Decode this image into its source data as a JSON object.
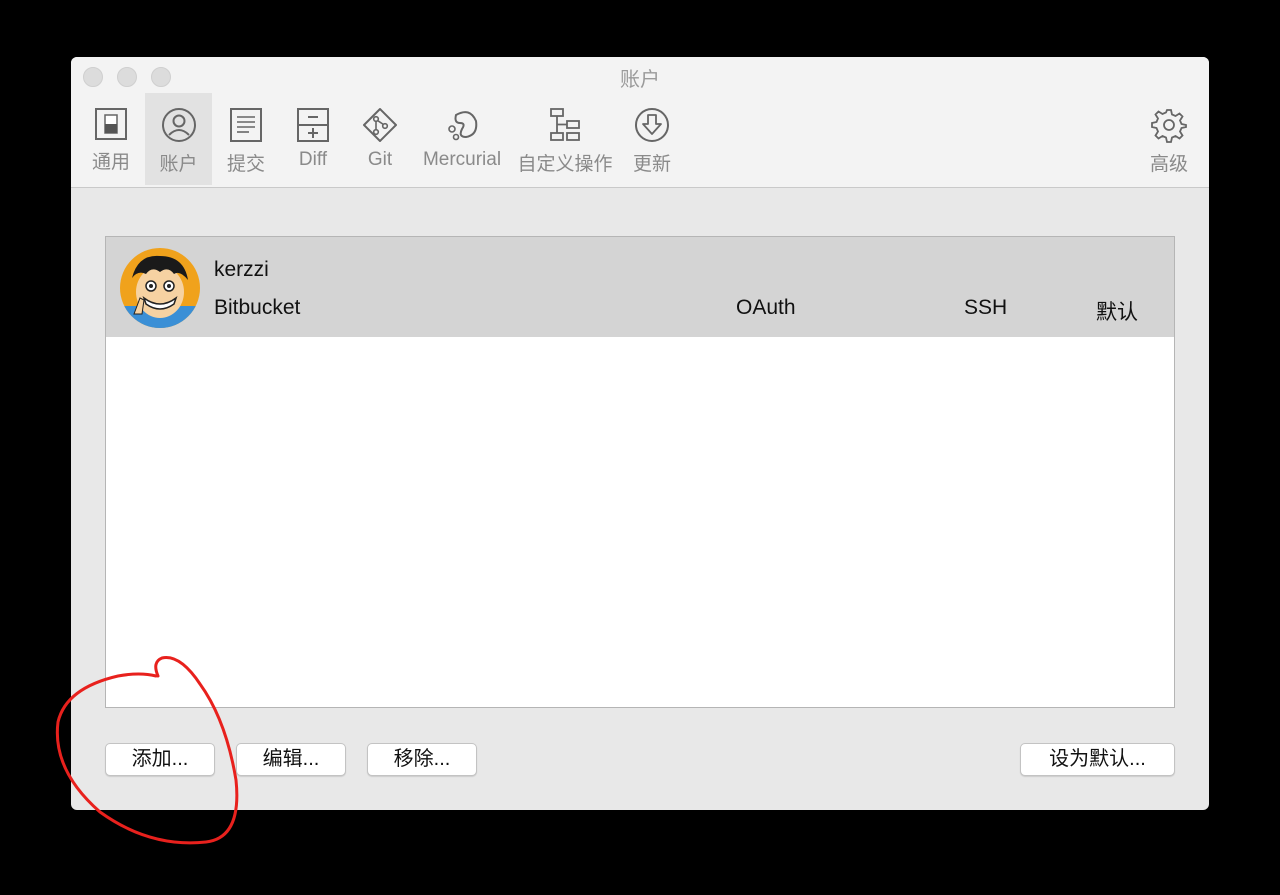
{
  "window": {
    "title": "账户"
  },
  "toolbar": {
    "items": [
      {
        "label": "通用",
        "icon": "switch-icon"
      },
      {
        "label": "账户",
        "icon": "account-icon",
        "active": true
      },
      {
        "label": "提交",
        "icon": "commit-icon"
      },
      {
        "label": "Diff",
        "icon": "diff-icon"
      },
      {
        "label": "Git",
        "icon": "git-icon"
      },
      {
        "label": "Mercurial",
        "icon": "mercurial-icon"
      },
      {
        "label": "自定义操作",
        "icon": "custom-actions-icon"
      },
      {
        "label": "更新",
        "icon": "update-icon"
      },
      {
        "label": "高级",
        "icon": "gear-icon"
      }
    ]
  },
  "accounts": [
    {
      "username": "kerzzi",
      "host": "Bitbucket",
      "auth": "OAuth",
      "protocol": "SSH",
      "default": "默认"
    }
  ],
  "buttons": {
    "add": "添加...",
    "edit": "编辑...",
    "remove": "移除...",
    "set_default": "设为默认..."
  },
  "colors": {
    "window_bg": "#e8e8e8",
    "toolbar_bg": "#f3f3f3",
    "selected_row": "#d4d4d4",
    "annotation": "#e8211d"
  }
}
